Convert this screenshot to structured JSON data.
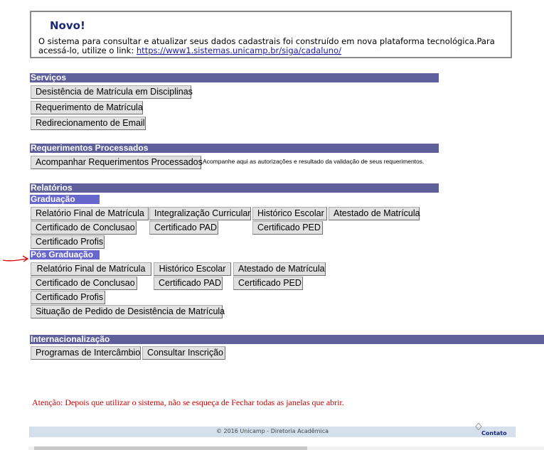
{
  "notice": {
    "title": "Novo!",
    "text": "O sistema para consultar e atualizar seus dados cadastrais foi construído em nova plataforma tecnológica.Para acessá-lo, utilize o link: ",
    "link": "https://www1.sistemas.unicamp.br/siga/cadaluno/"
  },
  "servicos": {
    "header": "Serviços",
    "buttons": [
      "Desistência de Matrícula em Disciplinas",
      "Requerimento de Matrícula",
      "Redirecionamento de Email"
    ]
  },
  "requerimentos": {
    "header": "Requerimentos Processados",
    "button": "Acompanhar Requerimentos Processados",
    "note": "Acompanhe aqui as autorizações e resultado da validação de seus requerimentos."
  },
  "relatorios": {
    "header": "Relatórios",
    "graduacao": {
      "header": "Graduação",
      "buttons": [
        "Relatório Final de Matrícula",
        "Integralização Curricular",
        "Histórico Escolar",
        "Atestado de Matrícula",
        "Certificado de Conclusao",
        "Certificado PAD",
        "Certificado PED",
        "Certificado Profis"
      ]
    },
    "pos_graduacao": {
      "header": "Pós Graduação",
      "buttons": [
        "Relatório Final de Matrícula",
        "Histórico Escolar",
        "Atestado de Matrícula",
        "Certificado de Conclusao",
        "Certificado PAD",
        "Certificado PED",
        "Certificado Profis",
        "Situação de Pedido de Desistência de Matrícula"
      ]
    }
  },
  "internacionalizacao": {
    "header": "Internacionalização",
    "buttons": [
      "Programas de Intercâmbio",
      "Consultar Inscrição"
    ]
  },
  "warning": "Atenção: Depois que utilizar o sistema, não se esqueça de Fechar todas as janelas que abrir.",
  "footer": {
    "copyright": "© 2016 Unicamp - Diretoria Acadêmica",
    "contato": "Contato"
  },
  "colors": {
    "section_bar": "#5f5f9c",
    "subsection_bar": "#6666cc",
    "warning": "#cc0000",
    "annotation_arrow": "#dd0000"
  }
}
